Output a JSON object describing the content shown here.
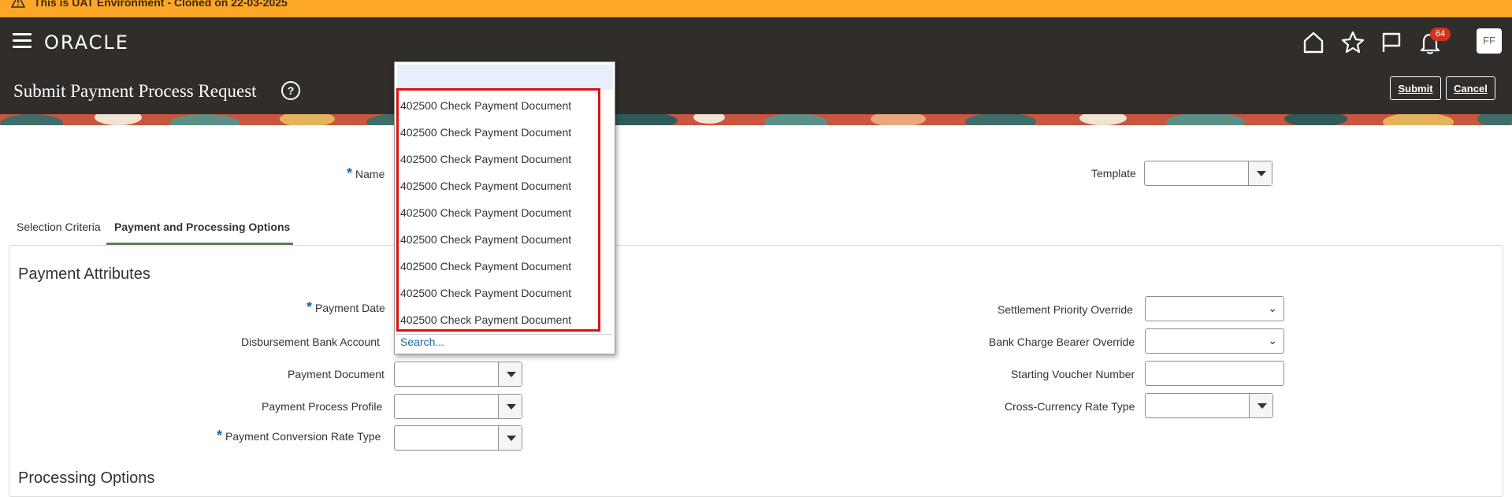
{
  "banner": {
    "text": "This is UAT Environment - Cloned on 22-03-2025",
    "color": "#fca728"
  },
  "header": {
    "logo": "ORACLE",
    "notification_count": "64",
    "avatar_initials": "FF",
    "icons": [
      "menu-icon",
      "home-icon",
      "star-icon",
      "flag-icon",
      "bell-icon"
    ],
    "background": "#312d2a"
  },
  "page": {
    "title": "Submit Payment Process Request",
    "help": "?",
    "submit_label": "Submit",
    "cancel_label": "Cancel"
  },
  "form": {
    "name_label": "Name",
    "template_label": "Template",
    "tabs": [
      "Selection Criteria",
      "Payment and Processing Options"
    ],
    "active_tab": "Payment and Processing Options"
  },
  "payment_attributes": {
    "title": "Payment Attributes",
    "payment_date_label": "Payment Date",
    "disbursement_bank_account_label": "Disbursement Bank Account",
    "payment_document_label": "Payment Document",
    "payment_process_profile_label": "Payment Process Profile",
    "payment_conversion_rate_type_label": "Payment Conversion Rate Type",
    "settlement_priority_override_label": "Settlement Priority Override",
    "bank_charge_bearer_override_label": "Bank Charge Bearer Override",
    "starting_voucher_number_label": "Starting Voucher Number",
    "cross_currency_rate_type_label": "Cross-Currency Rate Type"
  },
  "processing_options": {
    "title": "Processing Options"
  },
  "dropdown": {
    "items": [
      "402500 Check Payment Document",
      "402500 Check Payment Document",
      "402500 Check Payment Document",
      "402500 Check Payment Document",
      "402500 Check Payment Document",
      "402500 Check Payment Document",
      "402500 Check Payment Document",
      "402500 Check Payment Document",
      "402500 Check Payment Document"
    ],
    "search_label": "Search...",
    "highlight_color": "#e01010"
  }
}
